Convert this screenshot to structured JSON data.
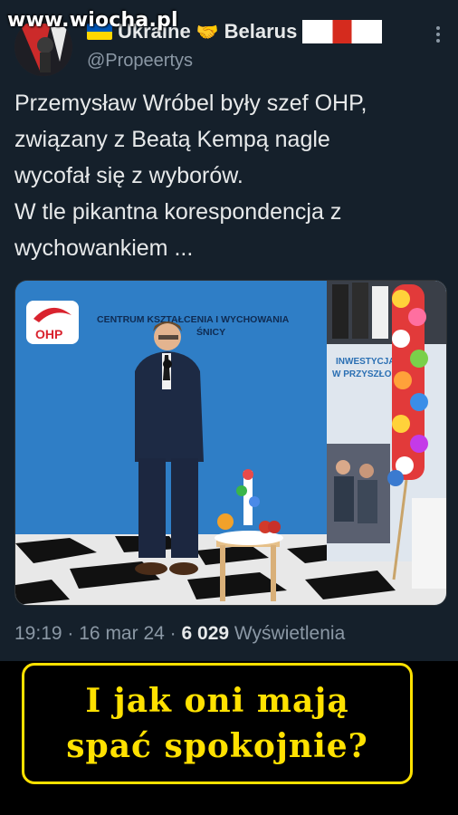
{
  "watermark": "www.wiocha.pl",
  "author": {
    "display_name_part1": "Ukraine",
    "display_name_part2": "Belarus",
    "handle": "@Propeertys",
    "flags": [
      "ukraine-flag",
      "belarus-flag"
    ],
    "separator_icon": "handshake-icon"
  },
  "more_icon": "⋮",
  "tweet": {
    "text": "Przemysław Wróbel były szef OHP,\nzwiązany z Beatą Kempą nagle\nwycofał się z wyborów.\nW tle pikantna korespondencja z\nwychowankiem ..."
  },
  "photo": {
    "logo_text": "OHP",
    "banner_text_line1": "CENTRUM KSZTAŁCENIA I WYCHOWANIA",
    "banner_text_line2": "ŚNICY",
    "rollup_text_line1": "INWESTYCJA",
    "rollup_text_line2": "W PRZYSZŁO"
  },
  "meta": {
    "time": "19:19",
    "date": "16 mar 24",
    "views_count": "6 029",
    "views_label": "Wyświetlenia"
  },
  "caption": {
    "line1": "I jak oni mają",
    "line2": "spać spokojnie?"
  },
  "colors": {
    "background": "#15202b",
    "text": "#e7e9ea",
    "muted": "#8b98a5",
    "caption_yellow": "#ffe100"
  }
}
